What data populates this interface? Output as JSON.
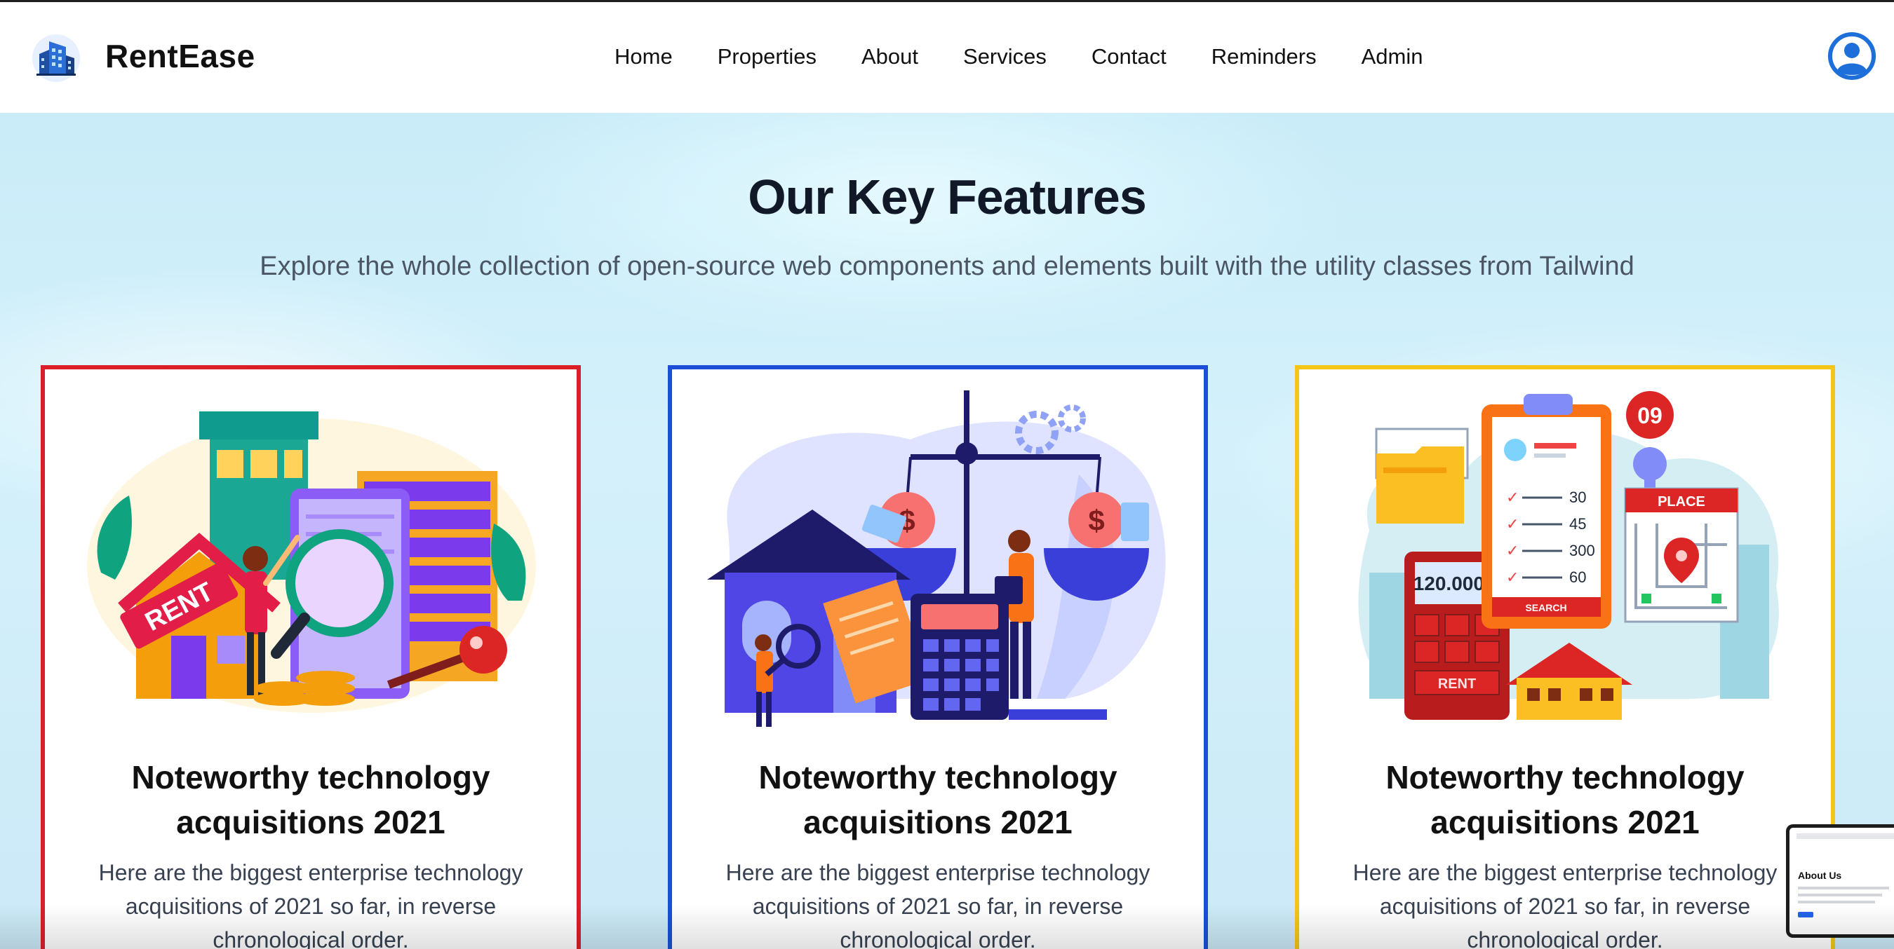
{
  "app": {
    "brand": "RentEase",
    "accent": "#111111"
  },
  "nav": {
    "items": [
      {
        "label": "Home"
      },
      {
        "label": "Properties"
      },
      {
        "label": "About"
      },
      {
        "label": "Services"
      },
      {
        "label": "Contact"
      },
      {
        "label": "Reminders"
      },
      {
        "label": "Admin"
      }
    ]
  },
  "header": {
    "logo_icon": "building-logo-icon",
    "user_icon": "user-account-icon",
    "user_icon_color": "#1e6fd9"
  },
  "features": {
    "title": "Our Key Features",
    "subtitle": "Explore the whole collection of open-source web components and elements built with the utility classes from Tailwind",
    "cards": [
      {
        "title": "Noteworthy technology acquisitions 2021",
        "body": "Here are the biggest enterprise technology acquisitions of 2021 so far, in reverse chronological order.",
        "border_color": "#dc1f26",
        "illustration": "rent-house-illustration",
        "illustration_text": "RENT"
      },
      {
        "title": "Noteworthy technology acquisitions 2021",
        "body": "Here are the biggest enterprise technology acquisitions of 2021 so far, in reverse chronological order.",
        "border_color": "#1d4ed8",
        "illustration": "mortgage-scale-illustration"
      },
      {
        "title": "Noteworthy technology acquisitions 2021",
        "body": "Here are the biggest enterprise technology acquisitions of 2021 so far, in reverse chronological order.",
        "border_color": "#f5c518",
        "illustration": "property-search-illustration",
        "illustration_labels": {
          "price": "120.000 $",
          "date": "09",
          "place": "PLACE",
          "search": "SEARCH",
          "rent": "RENT",
          "list": [
            "30",
            "45",
            "300",
            "60"
          ]
        }
      }
    ]
  },
  "preview_thumbnail": {
    "title": "About Us"
  }
}
